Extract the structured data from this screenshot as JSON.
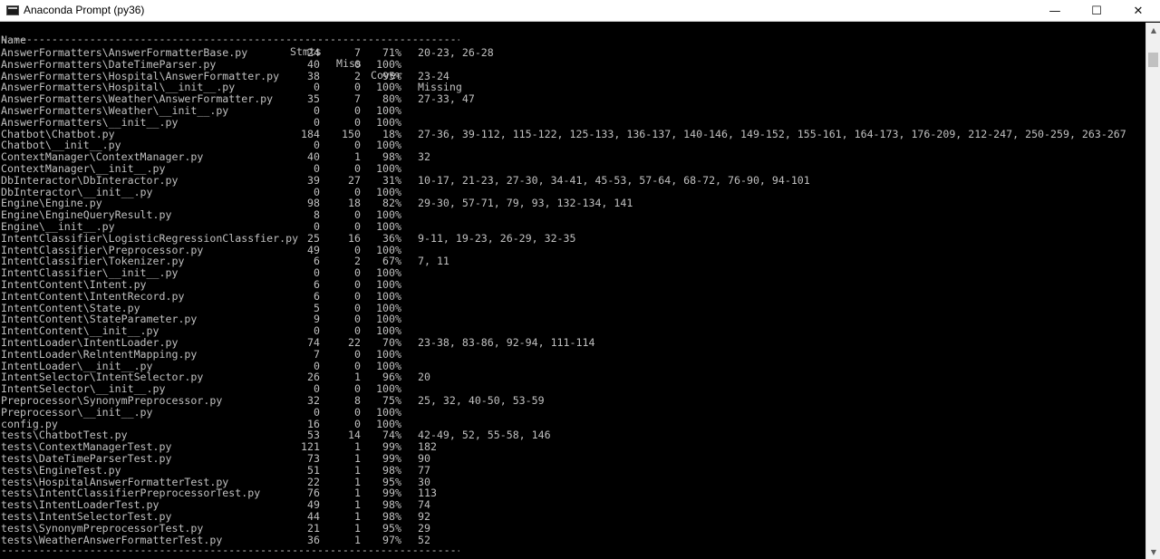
{
  "window": {
    "title": "Anaconda Prompt (py36)",
    "minimize": "—",
    "maximize": "☐",
    "close": "✕",
    "icon": "console-icon"
  },
  "report": {
    "headers": {
      "name": "Name",
      "stmts": "Stmts",
      "miss": "Miss",
      "cover": "Cover",
      "missing": "Missing"
    },
    "separator": "------------------------------------------------------------------------------------------------------------------------------",
    "rows": [
      {
        "name": "AnswerFormatters\\AnswerFormatterBase.py",
        "stmts": "24",
        "miss": "7",
        "cover": "71%",
        "missing": "20-23, 26-28"
      },
      {
        "name": "AnswerFormatters\\DateTimeParser.py",
        "stmts": "40",
        "miss": "0",
        "cover": "100%",
        "missing": ""
      },
      {
        "name": "AnswerFormatters\\Hospital\\AnswerFormatter.py",
        "stmts": "38",
        "miss": "2",
        "cover": "95%",
        "missing": "23-24"
      },
      {
        "name": "AnswerFormatters\\Hospital\\__init__.py",
        "stmts": "0",
        "miss": "0",
        "cover": "100%",
        "missing": ""
      },
      {
        "name": "AnswerFormatters\\Weather\\AnswerFormatter.py",
        "stmts": "35",
        "miss": "7",
        "cover": "80%",
        "missing": "27-33, 47"
      },
      {
        "name": "AnswerFormatters\\Weather\\__init__.py",
        "stmts": "0",
        "miss": "0",
        "cover": "100%",
        "missing": ""
      },
      {
        "name": "AnswerFormatters\\__init__.py",
        "stmts": "0",
        "miss": "0",
        "cover": "100%",
        "missing": ""
      },
      {
        "name": "Chatbot\\Chatbot.py",
        "stmts": "184",
        "miss": "150",
        "cover": "18%",
        "missing": "27-36, 39-112, 115-122, 125-133, 136-137, 140-146, 149-152, 155-161, 164-173, 176-209, 212-247, 250-259, 263-267"
      },
      {
        "name": "Chatbot\\__init__.py",
        "stmts": "0",
        "miss": "0",
        "cover": "100%",
        "missing": ""
      },
      {
        "name": "ContextManager\\ContextManager.py",
        "stmts": "40",
        "miss": "1",
        "cover": "98%",
        "missing": "32"
      },
      {
        "name": "ContextManager\\__init__.py",
        "stmts": "0",
        "miss": "0",
        "cover": "100%",
        "missing": ""
      },
      {
        "name": "DbInteractor\\DbInteractor.py",
        "stmts": "39",
        "miss": "27",
        "cover": "31%",
        "missing": "10-17, 21-23, 27-30, 34-41, 45-53, 57-64, 68-72, 76-90, 94-101"
      },
      {
        "name": "DbInteractor\\__init__.py",
        "stmts": "0",
        "miss": "0",
        "cover": "100%",
        "missing": ""
      },
      {
        "name": "Engine\\Engine.py",
        "stmts": "98",
        "miss": "18",
        "cover": "82%",
        "missing": "29-30, 57-71, 79, 93, 132-134, 141"
      },
      {
        "name": "Engine\\EngineQueryResult.py",
        "stmts": "8",
        "miss": "0",
        "cover": "100%",
        "missing": ""
      },
      {
        "name": "Engine\\__init__.py",
        "stmts": "0",
        "miss": "0",
        "cover": "100%",
        "missing": ""
      },
      {
        "name": "IntentClassifier\\LogisticRegressionClassfier.py",
        "stmts": "25",
        "miss": "16",
        "cover": "36%",
        "missing": "9-11, 19-23, 26-29, 32-35"
      },
      {
        "name": "IntentClassifier\\Preprocessor.py",
        "stmts": "49",
        "miss": "0",
        "cover": "100%",
        "missing": ""
      },
      {
        "name": "IntentClassifier\\Tokenizer.py",
        "stmts": "6",
        "miss": "2",
        "cover": "67%",
        "missing": "7, 11"
      },
      {
        "name": "IntentClassifier\\__init__.py",
        "stmts": "0",
        "miss": "0",
        "cover": "100%",
        "missing": ""
      },
      {
        "name": "IntentContent\\Intent.py",
        "stmts": "6",
        "miss": "0",
        "cover": "100%",
        "missing": ""
      },
      {
        "name": "IntentContent\\IntentRecord.py",
        "stmts": "6",
        "miss": "0",
        "cover": "100%",
        "missing": ""
      },
      {
        "name": "IntentContent\\State.py",
        "stmts": "5",
        "miss": "0",
        "cover": "100%",
        "missing": ""
      },
      {
        "name": "IntentContent\\StateParameter.py",
        "stmts": "9",
        "miss": "0",
        "cover": "100%",
        "missing": ""
      },
      {
        "name": "IntentContent\\__init__.py",
        "stmts": "0",
        "miss": "0",
        "cover": "100%",
        "missing": ""
      },
      {
        "name": "IntentLoader\\IntentLoader.py",
        "stmts": "74",
        "miss": "22",
        "cover": "70%",
        "missing": "23-38, 83-86, 92-94, 111-114"
      },
      {
        "name": "IntentLoader\\RelntentMapping.py",
        "stmts": "7",
        "miss": "0",
        "cover": "100%",
        "missing": ""
      },
      {
        "name": "IntentLoader\\__init__.py",
        "stmts": "0",
        "miss": "0",
        "cover": "100%",
        "missing": ""
      },
      {
        "name": "IntentSelector\\IntentSelector.py",
        "stmts": "26",
        "miss": "1",
        "cover": "96%",
        "missing": "20"
      },
      {
        "name": "IntentSelector\\__init__.py",
        "stmts": "0",
        "miss": "0",
        "cover": "100%",
        "missing": ""
      },
      {
        "name": "Preprocessor\\SynonymPreprocessor.py",
        "stmts": "32",
        "miss": "8",
        "cover": "75%",
        "missing": "25, 32, 40-50, 53-59"
      },
      {
        "name": "Preprocessor\\__init__.py",
        "stmts": "0",
        "miss": "0",
        "cover": "100%",
        "missing": ""
      },
      {
        "name": "config.py",
        "stmts": "16",
        "miss": "0",
        "cover": "100%",
        "missing": ""
      },
      {
        "name": "tests\\ChatbotTest.py",
        "stmts": "53",
        "miss": "14",
        "cover": "74%",
        "missing": "42-49, 52, 55-58, 146"
      },
      {
        "name": "tests\\ContextManagerTest.py",
        "stmts": "121",
        "miss": "1",
        "cover": "99%",
        "missing": "182"
      },
      {
        "name": "tests\\DateTimeParserTest.py",
        "stmts": "73",
        "miss": "1",
        "cover": "99%",
        "missing": "90"
      },
      {
        "name": "tests\\EngineTest.py",
        "stmts": "51",
        "miss": "1",
        "cover": "98%",
        "missing": "77"
      },
      {
        "name": "tests\\HospitalAnswerFormatterTest.py",
        "stmts": "22",
        "miss": "1",
        "cover": "95%",
        "missing": "30"
      },
      {
        "name": "tests\\IntentClassifierPreprocessorTest.py",
        "stmts": "76",
        "miss": "1",
        "cover": "99%",
        "missing": "113"
      },
      {
        "name": "tests\\IntentLoaderTest.py",
        "stmts": "49",
        "miss": "1",
        "cover": "98%",
        "missing": "74"
      },
      {
        "name": "tests\\IntentSelectorTest.py",
        "stmts": "44",
        "miss": "1",
        "cover": "98%",
        "missing": "92"
      },
      {
        "name": "tests\\SynonymPreprocessorTest.py",
        "stmts": "21",
        "miss": "1",
        "cover": "95%",
        "missing": "29"
      },
      {
        "name": "tests\\WeatherAnswerFormatterTest.py",
        "stmts": "36",
        "miss": "1",
        "cover": "97%",
        "missing": "52"
      }
    ]
  }
}
